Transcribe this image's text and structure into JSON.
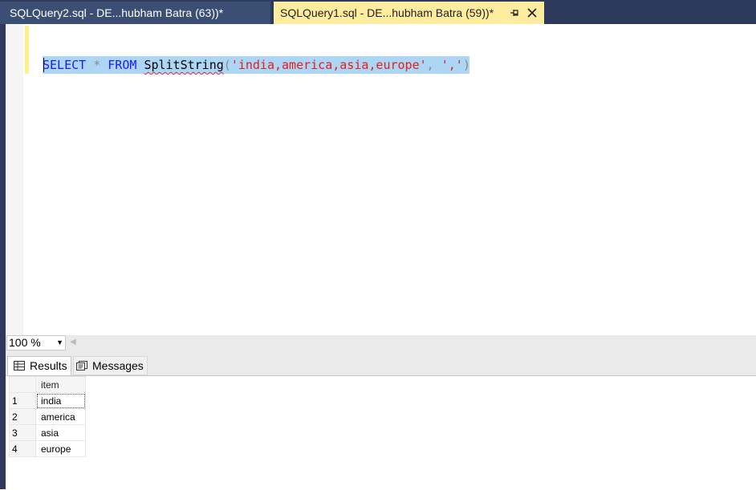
{
  "tabs": [
    {
      "label": "SQLQuery2.sql - DE...hubham Batra (63))*",
      "active": false
    },
    {
      "label": "SQLQuery1.sql - DE...hubham Batra (59))*",
      "active": true
    }
  ],
  "tab_icons": {
    "pin": "pin-icon",
    "close": "close-icon"
  },
  "editor": {
    "tokens": {
      "select_kw": "SELECT",
      "star": " * ",
      "from_kw": "FROM",
      "space": " ",
      "function_name": "SplitString",
      "open_paren": "(",
      "arg1": "'india,america,asia,europe'",
      "comma": ", ",
      "arg2": "','",
      "close_paren": ")"
    }
  },
  "zoom": {
    "value": "100 %"
  },
  "result_tabs": {
    "results": "Results",
    "messages": "Messages"
  },
  "grid": {
    "columns": [
      "item"
    ],
    "rows": [
      {
        "num": "1",
        "item": "india"
      },
      {
        "num": "2",
        "item": "america"
      },
      {
        "num": "3",
        "item": "asia"
      },
      {
        "num": "4",
        "item": "europe"
      }
    ]
  },
  "colors": {
    "frame": "#2d3a5c",
    "active_tab": "#ffec9e",
    "keyword": "#1a1aff",
    "string": "#e01e1e",
    "selection": "#add6f5"
  }
}
